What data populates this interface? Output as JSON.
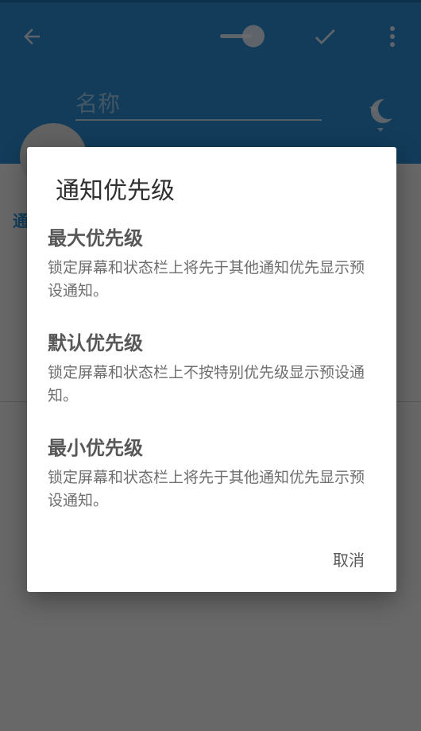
{
  "app_bar": {
    "name_placeholder": "名称",
    "color": "#2b8fd6"
  },
  "background": {
    "section_label": "通"
  },
  "dialog": {
    "title": "通知优先级",
    "options": [
      {
        "title": "最大优先级",
        "description": "锁定屏幕和状态栏上将先于其他通知优先显示预设通知。"
      },
      {
        "title": "默认优先级",
        "description": "锁定屏幕和状态栏上不按特别优先级显示预设通知。"
      },
      {
        "title": "最小优先级",
        "description": "锁定屏幕和状态栏上将先于其他通知优先显示预设通知。"
      }
    ],
    "cancel_label": "取消"
  },
  "icons": {
    "back": "arrow-back-icon",
    "toggle": "toggle-switch-icon",
    "confirm": "check-icon",
    "more": "more-vert-icon",
    "night": "moon-star-icon"
  }
}
